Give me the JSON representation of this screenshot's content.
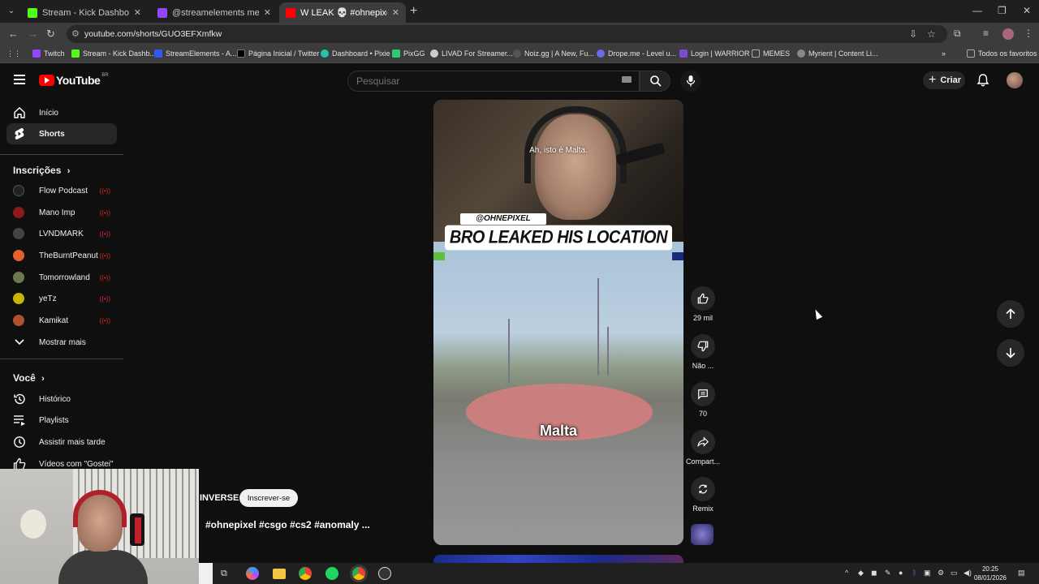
{
  "browser": {
    "tabs": [
      {
        "title": "Stream - Kick Dashboard",
        "favicon_color": "#53fc18"
      },
      {
        "title": "@streamelements mention",
        "favicon_color": "#9146ff"
      },
      {
        "title": "W LEAK 💀 #ohnepixel #cs",
        "favicon_color": "#ff0000"
      }
    ],
    "url": "youtube.com/shorts/GUO3EFXmfkw",
    "bookmarks": [
      {
        "label": "Twitch",
        "color": "#9146ff"
      },
      {
        "label": "Stream - Kick Dashb...",
        "color": "#53fc18"
      },
      {
        "label": "StreamElements - A...",
        "color": "#2b5bf0"
      },
      {
        "label": "Página Inicial / Twitter",
        "color": "#000000"
      },
      {
        "label": "Dashboard • Pixie",
        "color": "#22c7a9"
      },
      {
        "label": "PixGG",
        "color": "#2ecc71"
      },
      {
        "label": "LIVAD For Streamer...",
        "color": "#cccccc"
      },
      {
        "label": "Noiz.gg | A New, Fu...",
        "color": "#555555"
      },
      {
        "label": "Drope.me - Level u...",
        "color": "#6b6bf0"
      },
      {
        "label": "Login | WARRIOR",
        "color": "#7a4ad0"
      },
      {
        "label": "MEMES",
        "color": "#aaaaaa"
      },
      {
        "label": "Myrient | Content Li...",
        "color": "#888888"
      }
    ],
    "all_bookmarks": "Todos os favoritos"
  },
  "header": {
    "logo": "YouTube",
    "region": "BR",
    "search_placeholder": "Pesquisar",
    "create_label": "Criar"
  },
  "sidebar": {
    "main": [
      {
        "label": "Início",
        "icon": "home-icon"
      },
      {
        "label": "Shorts",
        "icon": "shorts-icon"
      }
    ],
    "subscriptions_title": "Inscrições",
    "subscriptions": [
      {
        "label": "Flow Podcast",
        "color": "#222222"
      },
      {
        "label": "Mano Imp",
        "color": "#8b1a1a"
      },
      {
        "label": "LVNDMARK",
        "color": "#444444"
      },
      {
        "label": "TheBurntPeanut",
        "color": "#e5602a"
      },
      {
        "label": "Tomorrowland",
        "color": "#6b7a4a"
      },
      {
        "label": "yeTz",
        "color": "#c9b400"
      },
      {
        "label": "Kamikat",
        "color": "#b05030"
      }
    ],
    "show_more": "Mostrar mais",
    "you_title": "Você",
    "you_items": [
      {
        "label": "Histórico",
        "icon": "history-icon"
      },
      {
        "label": "Playlists",
        "icon": "playlists-icon"
      },
      {
        "label": "Assistir mais tarde",
        "icon": "watch-later-icon"
      },
      {
        "label": "Vídeos com \"Gostei\"",
        "icon": "thumbs-up-icon"
      }
    ]
  },
  "short": {
    "caption_top": "Ah, isto é Malta.",
    "handle_tag": "@OHNEPIXEL",
    "headline": "BRO LEAKED HIS LOCATION",
    "caption_bottom": "Malta",
    "channel_name": "INVERSE",
    "subscribe_label": "Inscrever-se",
    "hashtags": "#ohnepixel #csgo #cs2 #anomaly ..."
  },
  "actions": {
    "likes": "29 mil",
    "dislike": "Não ...",
    "comments": "70",
    "share": "Compart...",
    "remix": "Remix"
  },
  "taskbar": {
    "time": "20:25",
    "date": "08/01/2026"
  }
}
